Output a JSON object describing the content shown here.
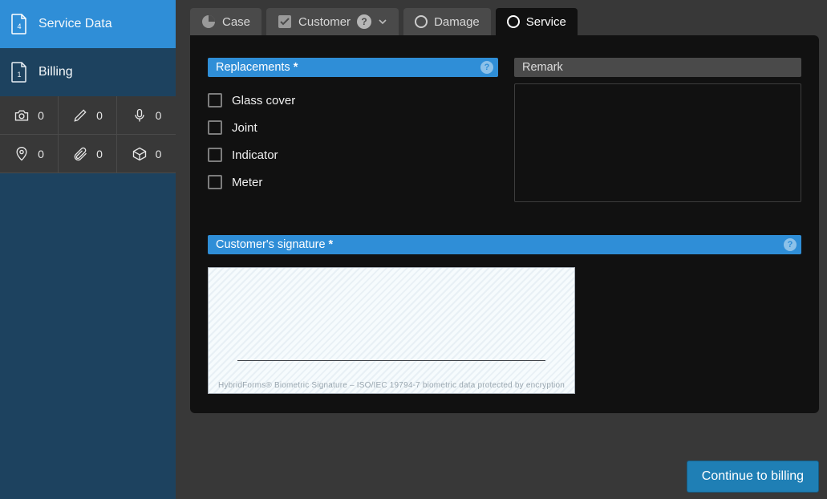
{
  "sidebar": {
    "items": [
      {
        "label": "Service Data",
        "badge": "4"
      },
      {
        "label": "Billing",
        "badge": "1"
      }
    ]
  },
  "media": {
    "camera": 0,
    "pencil": 0,
    "mic": 0,
    "location": 0,
    "attach": 0,
    "package": 0
  },
  "tabs": {
    "case": "Case",
    "customer": "Customer",
    "damage": "Damage",
    "service": "Service"
  },
  "sections": {
    "replacements": {
      "title": "Replacements",
      "required": "*"
    },
    "remark": {
      "title": "Remark"
    },
    "signature": {
      "title": "Customer's signature",
      "required": "*"
    }
  },
  "replacements": {
    "opt1": "Glass cover",
    "opt2": "Joint",
    "opt3": "Indicator",
    "opt4": "Meter"
  },
  "signature_pad": {
    "footer": "HybridForms® Biometric Signature  –  ISO/IEC 19794-7 biometric data protected by encryption"
  },
  "actions": {
    "continue": "Continue to billing"
  }
}
